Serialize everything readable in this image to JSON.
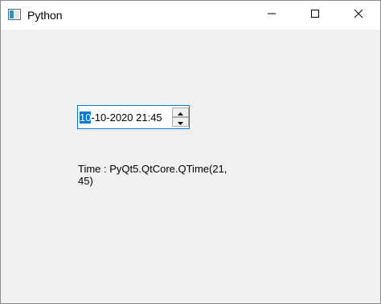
{
  "window": {
    "title": "Python",
    "icon": "python-window-icon",
    "controls": {
      "minimize_icon": "minimize-icon",
      "maximize_icon": "maximize-icon",
      "close_icon": "close-icon"
    }
  },
  "datetime_edit": {
    "selected_section": "10",
    "rest_text": "-10-2020 21:45",
    "accent_color": "#0078d7",
    "up_icon": "arrow-up-icon",
    "down_icon": "arrow-down-icon"
  },
  "time_label": {
    "line1": "Time : PyQt5.QtCore.QTime(21,",
    "line2": "45)"
  }
}
